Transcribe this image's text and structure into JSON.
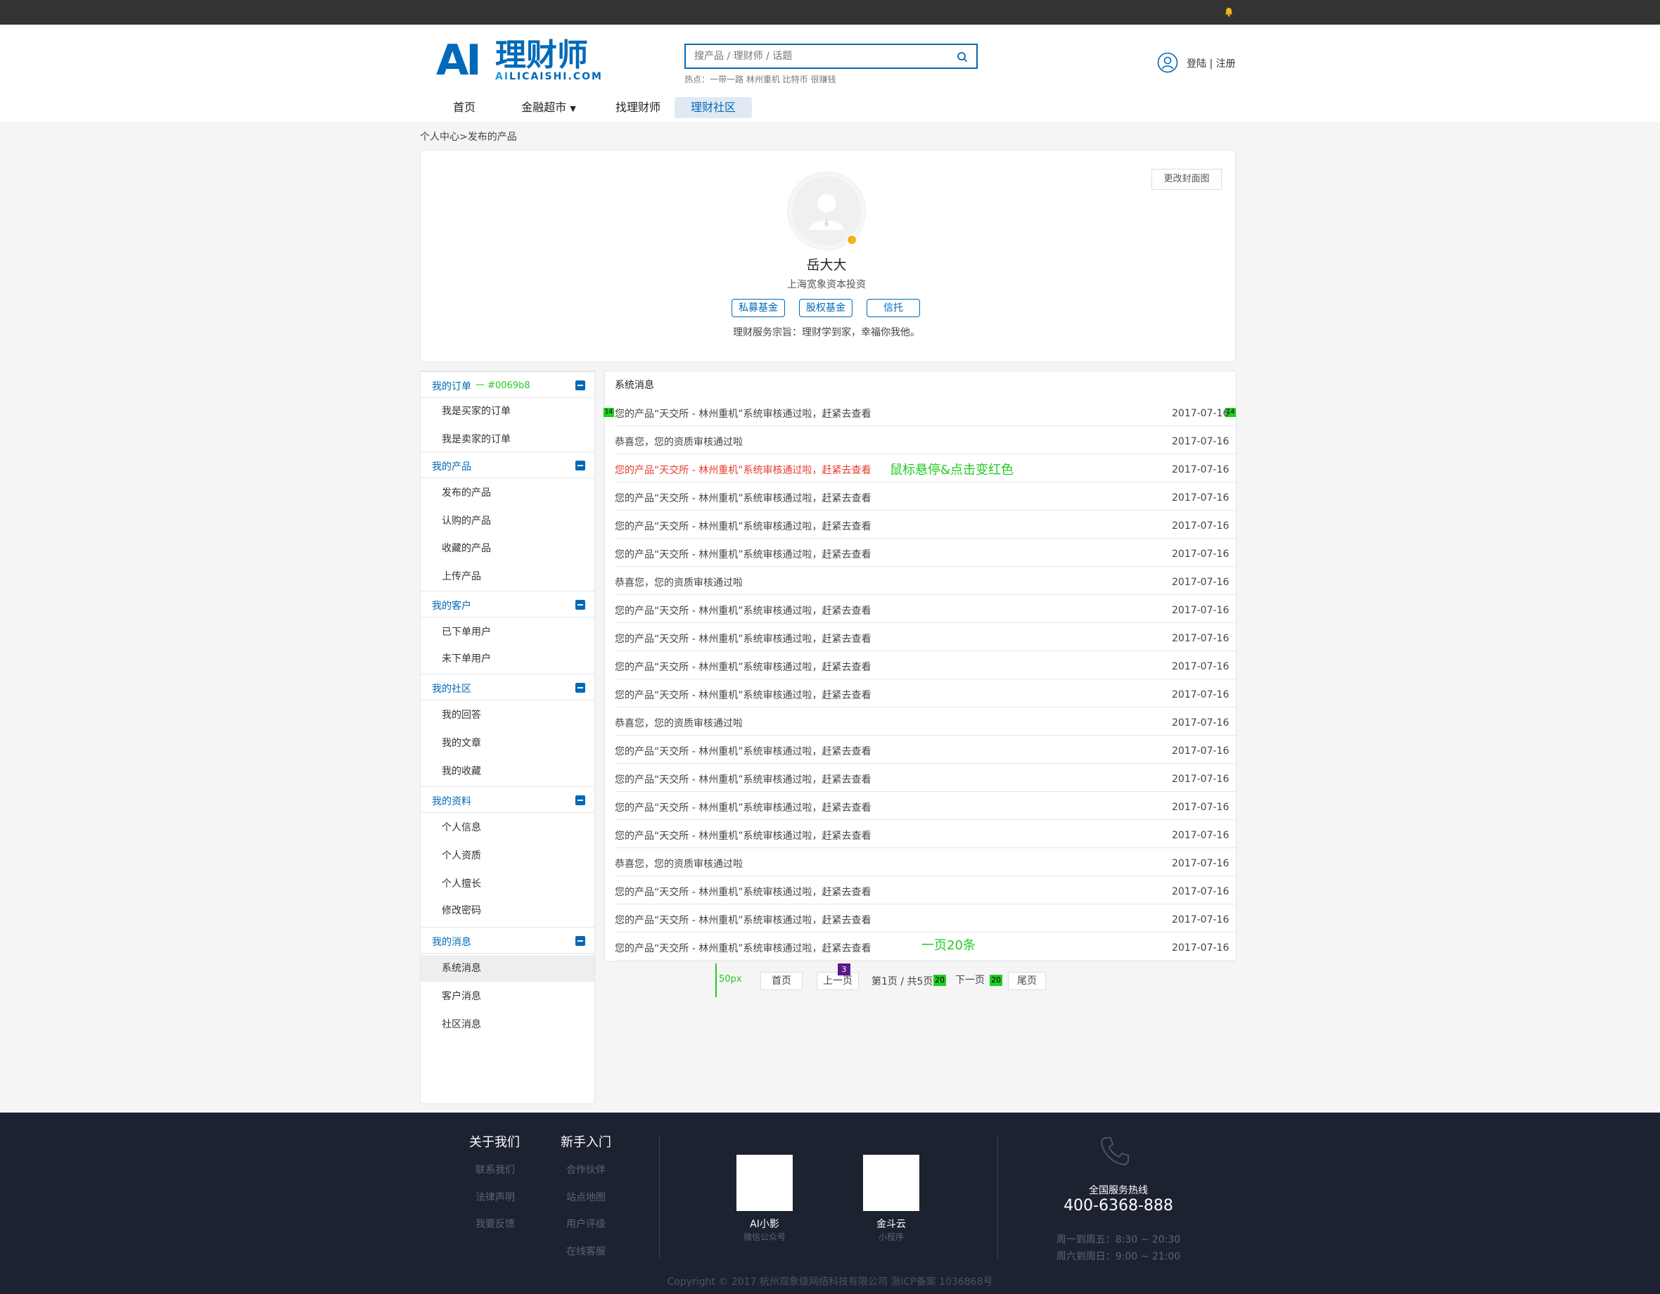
{
  "header": {
    "logo_ai": "AI",
    "logo_cn": "理财师",
    "logo_en_a": "AI",
    "logo_en_b": "LICAISHI.COM",
    "search_placeholder": "搜产品 / 理财师 / 话题",
    "hot": "热点：一带一路 林州重机 比特币 很赚钱",
    "login": "登陆 | 注册"
  },
  "nav": {
    "home": "首页",
    "market": "金融超市",
    "find": "找理财师",
    "community": "理财社区"
  },
  "breadcrumb": "个人中心>发布的产品",
  "profile": {
    "cover_btn": "更改封面图",
    "name": "岳大大",
    "company": "上海宽象资本投资",
    "tags": [
      "私募基金",
      "股权基金",
      "信托"
    ],
    "motto": "理财服务宗旨：理财学到家，幸福你我他。"
  },
  "sidebar": {
    "note_color": "一 #0069b8",
    "sections": [
      {
        "title": "我的订单",
        "items": [
          "我是买家的订单",
          "我是卖家的订单"
        ]
      },
      {
        "title": "我的产品",
        "items": [
          "发布的产品",
          "认购的产品",
          "收藏的产品",
          "上传产品"
        ]
      },
      {
        "title": "我的客户",
        "items": [
          "已下单用户",
          "未下单用户"
        ]
      },
      {
        "title": "我的社区",
        "items": [
          "我的回答",
          "我的文章",
          "我的收藏"
        ]
      },
      {
        "title": "我的资料",
        "items": [
          "个人信息",
          "个人资质",
          "个人擅长",
          "修改密码"
        ]
      },
      {
        "title": "我的消息",
        "items": [
          "系统消息",
          "客户消息",
          "社区消息"
        ]
      }
    ]
  },
  "messages": {
    "title": "系统消息",
    "hover_note": "鼠标悬停&点击变红色",
    "count_note": "一页20条",
    "mark_left": "14",
    "mark_right": "14",
    "rows": [
      {
        "text": "您的产品“天交所 - 林州重机”系统审核通过啦，赶紧去查看",
        "date": "2017-07-16"
      },
      {
        "text": "恭喜您，您的资质审核通过啦",
        "date": "2017-07-16"
      },
      {
        "text": "您的产品“天交所 - 林州重机”系统审核通过啦，赶紧去查看",
        "date": "2017-07-16"
      },
      {
        "text": "您的产品“天交所 - 林州重机”系统审核通过啦，赶紧去查看",
        "date": "2017-07-16"
      },
      {
        "text": "您的产品“天交所 - 林州重机”系统审核通过啦，赶紧去查看",
        "date": "2017-07-16"
      },
      {
        "text": "您的产品“天交所 - 林州重机”系统审核通过啦，赶紧去查看",
        "date": "2017-07-16"
      },
      {
        "text": "恭喜您，您的资质审核通过啦",
        "date": "2017-07-16"
      },
      {
        "text": "您的产品“天交所 - 林州重机”系统审核通过啦，赶紧去查看",
        "date": "2017-07-16"
      },
      {
        "text": "您的产品“天交所 - 林州重机”系统审核通过啦，赶紧去查看",
        "date": "2017-07-16"
      },
      {
        "text": "您的产品“天交所 - 林州重机”系统审核通过啦，赶紧去查看",
        "date": "2017-07-16"
      },
      {
        "text": "您的产品“天交所 - 林州重机”系统审核通过啦，赶紧去查看",
        "date": "2017-07-16"
      },
      {
        "text": "恭喜您，您的资质审核通过啦",
        "date": "2017-07-16"
      },
      {
        "text": "您的产品“天交所 - 林州重机”系统审核通过啦，赶紧去查看",
        "date": "2017-07-16"
      },
      {
        "text": "您的产品“天交所 - 林州重机”系统审核通过啦，赶紧去查看",
        "date": "2017-07-16"
      },
      {
        "text": "您的产品“天交所 - 林州重机”系统审核通过啦，赶紧去查看",
        "date": "2017-07-16"
      },
      {
        "text": "您的产品“天交所 - 林州重机”系统审核通过啦，赶紧去查看",
        "date": "2017-07-16"
      },
      {
        "text": "恭喜您，您的资质审核通过啦",
        "date": "2017-07-16"
      },
      {
        "text": "您的产品“天交所 - 林州重机”系统审核通过啦，赶紧去查看",
        "date": "2017-07-16"
      },
      {
        "text": "您的产品“天交所 - 林州重机”系统审核通过啦，赶紧去查看",
        "date": "2017-07-16"
      },
      {
        "text": "您的产品“天交所 - 林州重机”系统审核通过啦，赶紧去查看",
        "date": "2017-07-16"
      }
    ]
  },
  "pager": {
    "first": "首页",
    "prev": "上一页",
    "info": "第1页 / 共5页",
    "next": "下一页",
    "last": "尾页",
    "note_px": "50px",
    "mark_purple": "3",
    "mark_green": "20"
  },
  "footer": {
    "col1_title": "关于我们",
    "col1_links": [
      "联系我们",
      "法律声明",
      "我要反馈"
    ],
    "col2_title": "新手入门",
    "col2_links": [
      "合作伙伴",
      "站点地图",
      "用户评级",
      "在线客服"
    ],
    "qr1_label": "AI小影",
    "qr1_sub": "微信公众号",
    "qr2_label": "金斗云",
    "qr2_sub": "小程序",
    "hotline_label": "全国服务热线",
    "hotline_num": "400-6368-888",
    "hours1": "周一到周五：8:30 ~ 20:30",
    "hours2": "周六到周日：9:00 ~ 21:00",
    "copyright": "Copyright © 2017 杭州观象级网络科技有限公司 浙ICP备案 1036868号"
  },
  "colors": {
    "brand": "#0069b8",
    "hover": "#e83a2e",
    "annotation": "#22cc22"
  }
}
